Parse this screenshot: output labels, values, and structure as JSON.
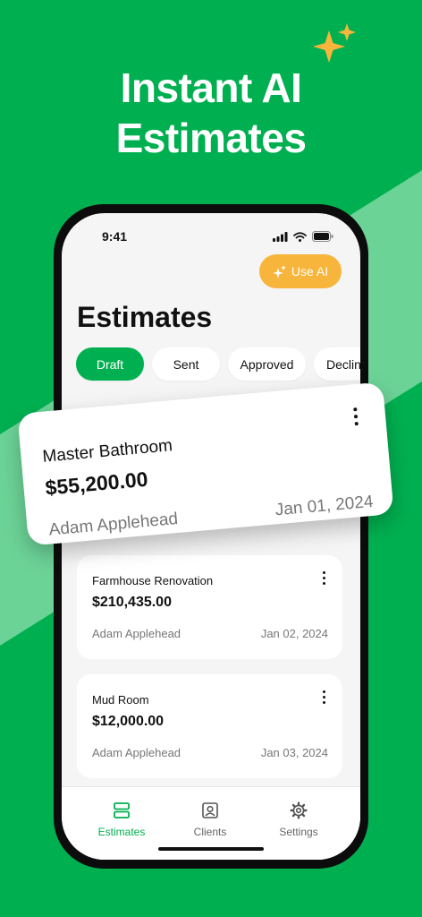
{
  "headline": {
    "line1": "Instant AI",
    "line2": "Estimates"
  },
  "status_bar": {
    "time": "9:41"
  },
  "use_ai": {
    "label": "Use AI"
  },
  "page_title": "Estimates",
  "filters": [
    {
      "label": "Draft",
      "active": true
    },
    {
      "label": "Sent",
      "active": false
    },
    {
      "label": "Approved",
      "active": false
    },
    {
      "label": "Declin",
      "active": false
    }
  ],
  "featured_estimate": {
    "name": "Master Bathroom",
    "amount": "$55,200.00",
    "client": "Adam Applehead",
    "date": "Jan 01, 2024"
  },
  "estimates": [
    {
      "name": "Farmhouse Renovation",
      "amount": "$210,435.00",
      "client": "Adam Applehead",
      "date": "Jan 02, 2024"
    },
    {
      "name": "Mud Room",
      "amount": "$12,000.00",
      "client": "Adam Applehead",
      "date": "Jan 03, 2024"
    }
  ],
  "tabbar": {
    "items": [
      {
        "label": "Estimates",
        "icon": "estimates-icon",
        "active": true
      },
      {
        "label": "Clients",
        "icon": "clients-icon",
        "active": false
      },
      {
        "label": "Settings",
        "icon": "gear-icon",
        "active": false
      }
    ]
  },
  "colors": {
    "brand_green": "#00b050",
    "accent_orange": "#f7b53c",
    "stripe_green": "#7fd9a3"
  }
}
